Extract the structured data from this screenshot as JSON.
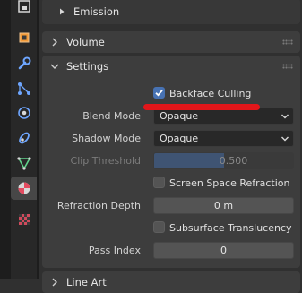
{
  "colors": {
    "background": "#303030",
    "panel": "#3d3d3d",
    "accent_checkbox": "#4772b3",
    "annotation": "#e2161a"
  },
  "sidebar": {
    "tabs": [
      {
        "icon": "render-icon",
        "active": false
      },
      {
        "icon": "object-icon",
        "active": false
      },
      {
        "icon": "wrench-icon",
        "active": false
      },
      {
        "icon": "particles-icon",
        "active": false
      },
      {
        "icon": "physics-icon",
        "active": false
      },
      {
        "icon": "constraints-icon",
        "active": false
      },
      {
        "icon": "object-data-icon",
        "active": false
      },
      {
        "icon": "material-icon",
        "active": true
      },
      {
        "icon": "texture-icon",
        "active": false
      }
    ]
  },
  "panels": {
    "emission": {
      "title": "Emission",
      "expanded": false
    },
    "volume": {
      "title": "Volume",
      "expanded": false
    },
    "settings": {
      "title": "Settings",
      "expanded": true
    },
    "line_art": {
      "title": "Line Art",
      "expanded": false
    }
  },
  "settings": {
    "backface_culling": {
      "label": "Backface Culling",
      "checked": true
    },
    "blend_mode": {
      "label": "Blend Mode",
      "value": "Opaque"
    },
    "shadow_mode": {
      "label": "Shadow Mode",
      "value": "Opaque"
    },
    "clip_threshold": {
      "label": "Clip Threshold",
      "value": "0.500",
      "fraction": 0.5,
      "enabled": false
    },
    "screen_space_refraction": {
      "label": "Screen Space Refraction",
      "checked": false
    },
    "refraction_depth": {
      "label": "Refraction Depth",
      "value": "0 m"
    },
    "subsurface_translucency": {
      "label": "Subsurface Translucency",
      "checked": false
    },
    "pass_index": {
      "label": "Pass Index",
      "value": "0"
    }
  }
}
